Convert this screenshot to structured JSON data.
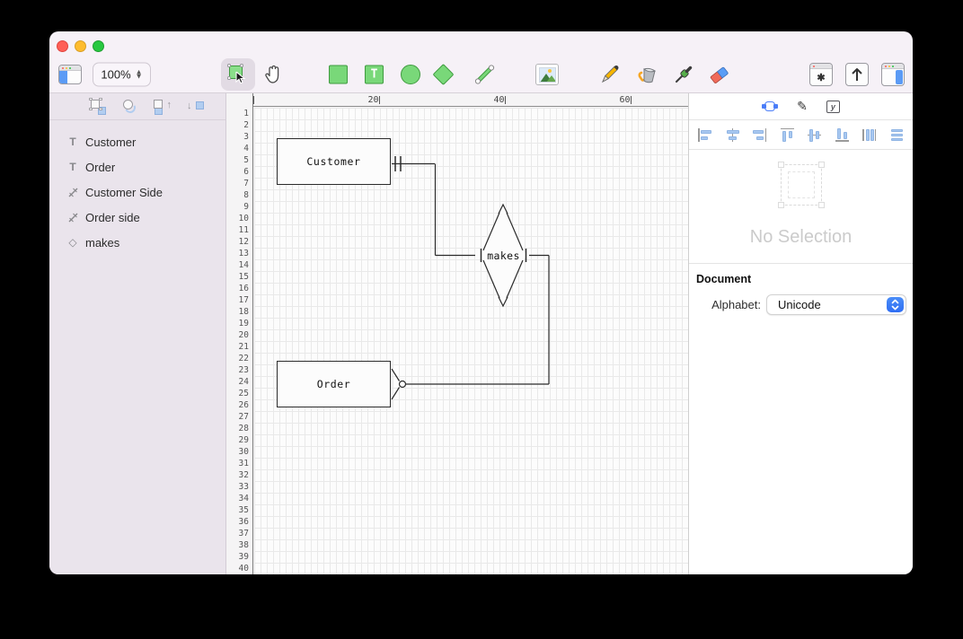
{
  "window": {
    "zoom_level": "100%"
  },
  "colors": {
    "accent_green": "#79d879",
    "accent_green_border": "#3f9b3f",
    "accent_blue": "#3b7df5",
    "chrome_bg": "#f6f1f7",
    "sidebar_bg": "#eae4ec",
    "canvas_bg": "#fcfcfc",
    "grid_line": "#e9e9e9",
    "diagram_stroke": "#2b2b2b",
    "no_selection_text": "#cbcbcb"
  },
  "toolbar": {
    "tools": [
      "toggle-left-sidebar",
      "zoom-level",
      "selection",
      "pan",
      "rectangle",
      "text",
      "ellipse",
      "diamond",
      "line",
      "image",
      "pencil",
      "fill",
      "eyedropper",
      "eraser",
      "special-characters",
      "export",
      "toggle-inspector"
    ]
  },
  "sidebar": {
    "arrange_icons": [
      "bring-to-front",
      "send-to-back",
      "bring-forward",
      "send-backward"
    ],
    "layers": [
      {
        "type": "text",
        "label": "Customer"
      },
      {
        "type": "text",
        "label": "Order"
      },
      {
        "type": "line",
        "label": "Customer Side"
      },
      {
        "type": "line",
        "label": "Order side"
      },
      {
        "type": "diamond",
        "label": "makes"
      }
    ]
  },
  "canvas": {
    "ruler_columns": [
      {
        "label": "20",
        "col": 20
      },
      {
        "label": "40",
        "col": 40
      },
      {
        "label": "60",
        "col": 60
      }
    ],
    "ruler_rows": [
      "1",
      "2",
      "3",
      "4",
      "5",
      "6",
      "7",
      "8",
      "9",
      "10",
      "11",
      "12",
      "13",
      "14",
      "15",
      "16",
      "17",
      "18",
      "19",
      "20",
      "21",
      "22",
      "23",
      "24",
      "25",
      "26",
      "27",
      "28",
      "29",
      "30",
      "31",
      "32",
      "33",
      "34",
      "35",
      "36",
      "37",
      "38",
      "39",
      "40"
    ],
    "entities": [
      {
        "label": "Customer"
      },
      {
        "label": "Order"
      }
    ],
    "relationship": {
      "label": "makes"
    },
    "notation": {
      "customer_end": "one-and-only-one",
      "order_end": "zero-or-many"
    }
  },
  "inspector": {
    "tabs": [
      "shape-inspector",
      "style-inspector",
      "advanced-inspector"
    ],
    "align_tools": [
      "align-left",
      "align-center-horizontal",
      "align-right",
      "align-top",
      "align-middle-vertical",
      "align-bottom",
      "distribute-horizontally",
      "distribute-vertically"
    ],
    "no_selection": "No Selection",
    "document_section": {
      "title": "Document",
      "alphabet_label": "Alphabet:",
      "alphabet_value": "Unicode"
    }
  }
}
